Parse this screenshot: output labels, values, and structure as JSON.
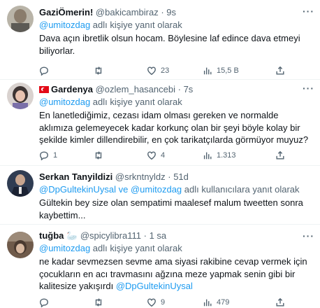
{
  "tweets": [
    {
      "name": "GaziÖmerin!",
      "handle": "@bakicambiraz",
      "dot": "·",
      "time": "9s",
      "reply_mention": "@umitozdag",
      "reply_suffix": " adlı kişiye yanıt olarak",
      "text": "Dava açın ibretlik olsun hocam. Böylesine laf edince dava etmeyi biliyorlar.",
      "replies": "",
      "retweets": "",
      "likes": "23",
      "views": "15,5 B"
    },
    {
      "name": "Gardenya",
      "handle": "@ozlem_hasancebi",
      "dot": "·",
      "time": "7s",
      "reply_mention": "@umitozdag",
      "reply_suffix": " adlı kişiye yanıt olarak",
      "text": "En lanetlediğimiz, cezası idam olması gereken ve normalde aklımıza gelemeyecek kadar korkunç olan bir şeyi böyle kolay bir şekilde kimler dillendirebilir, en çok tarikatçılarda görmüyor muyuz?",
      "replies": "1",
      "retweets": "",
      "likes": "4",
      "views": "1.313"
    },
    {
      "name": "Serkan Tanyildizi",
      "handle": "@srkntnyldz",
      "dot": "·",
      "time": "51d",
      "reply_mention_1": "@DpGultekinUysal",
      "reply_and": " ve ",
      "reply_mention_2": "@umitozdag",
      "reply_suffix": " adlı kullanıcılara yanıt olarak",
      "text": "Gültekin bey size olan sempatimi maalesef malum tweetten sonra kaybettim..."
    },
    {
      "name": "tuğba",
      "emoji": "🦢",
      "handle": "@spicylibra111",
      "dot": "·",
      "time": "1 sa",
      "reply_mention": "@umitozdag",
      "reply_suffix": " adlı kişiye yanıt olarak",
      "text_plain": "ne kadar sevmezsen sevme ama siyasi rakibine cevap vermek için çocukların en acı travmasını ağzına meze yapmak senin gibi bir kalitesize yakışırdı ",
      "text_mention": "@DpGultekinUysal",
      "replies": "",
      "retweets": "",
      "likes": "9",
      "views": "479"
    }
  ],
  "more_label": "···",
  "colors": {
    "accent": "#1d9bf0",
    "muted": "#536471",
    "text": "#0f1419",
    "divider": "#eff3f4"
  },
  "icons": [
    "reply-icon",
    "retweet-icon",
    "like-icon",
    "views-icon",
    "share-icon",
    "more-icon",
    "turkish-flag-icon"
  ]
}
